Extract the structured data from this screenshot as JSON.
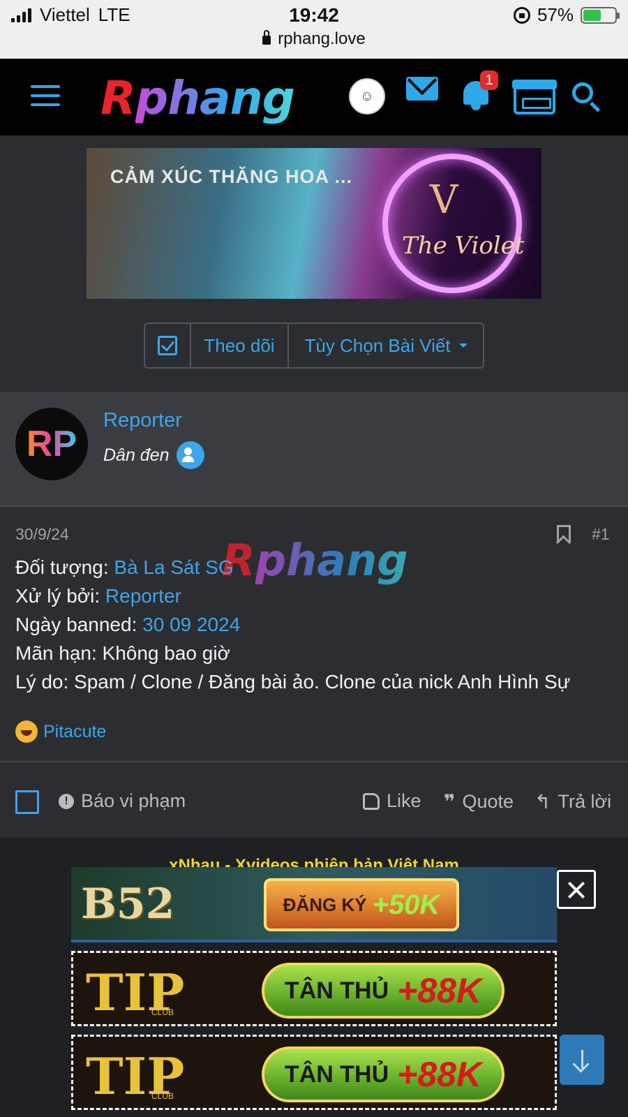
{
  "status_bar": {
    "carrier": "Viettel",
    "network": "LTE",
    "time": "19:42",
    "battery": "57%",
    "battery_level": 0.57,
    "url": "rphang.love"
  },
  "header": {
    "logo_r": "R",
    "logo_rest": "phang",
    "notification_count": "1",
    "icons": [
      "menu-icon",
      "avatar",
      "mail-icon",
      "bell-icon",
      "store-icon",
      "search-icon"
    ]
  },
  "banner": {
    "headline": "CẢM XÚC THĂNG HOA ...",
    "brand": "The Violet"
  },
  "thread_controls": {
    "follow_label": "Theo dõi",
    "options_label": "Tùy Chọn Bài Viết"
  },
  "post": {
    "avatar_text": "RP",
    "username": "Reporter",
    "user_title": "Dân đen",
    "date": "30/9/24",
    "number": "#1",
    "watermark_r": "R",
    "watermark_rest": "phang",
    "fields": {
      "target_label": "Đối tượng: ",
      "target_value": "Bà La Sát SG",
      "handled_label": "Xử lý bởi: ",
      "handled_value": "Reporter",
      "banned_label": "Ngày banned: ",
      "banned_value": "30 09 2024",
      "expiry": "Mãn hạn: Không bao giờ",
      "reason": "Lý do: Spam / Clone / Đăng bài ảo. Clone của nick Anh Hình Sự"
    },
    "reaction_user": "Pitacute"
  },
  "post_actions": {
    "report": "Báo vi phạm",
    "like": "Like",
    "quote": "Quote",
    "reply": "Trả lời"
  },
  "below_text": "xNhau - Xvideos phiên bản Việt Nam",
  "ads": {
    "b52_logo": "B52",
    "b52_cta_text": "ĐĂNG KÝ",
    "b52_cta_amount": "+50K",
    "tip_logo": "TIP",
    "tip_club": "CLUB",
    "tip_cta_text": "TÂN THỦ",
    "tip_cta_amount": "+88K"
  }
}
